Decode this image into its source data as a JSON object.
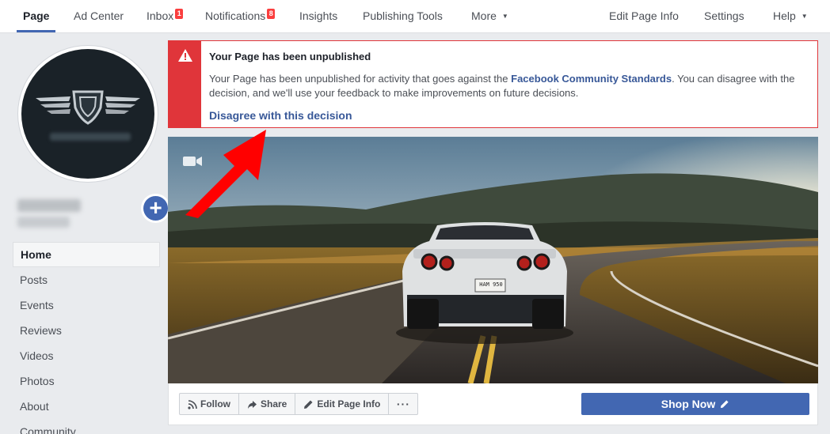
{
  "topnav": {
    "left": [
      {
        "label": "Page"
      },
      {
        "label": "Ad Center"
      },
      {
        "label": "Inbox",
        "badge": "1"
      },
      {
        "label": "Notifications",
        "badge": "8"
      },
      {
        "label": "Insights"
      },
      {
        "label": "Publishing Tools"
      },
      {
        "label": "More"
      }
    ],
    "right": [
      {
        "label": "Edit Page Info"
      },
      {
        "label": "Settings"
      },
      {
        "label": "Help"
      }
    ]
  },
  "sidebar": {
    "items": [
      {
        "label": "Home"
      },
      {
        "label": "Posts"
      },
      {
        "label": "Events"
      },
      {
        "label": "Reviews"
      },
      {
        "label": "Videos"
      },
      {
        "label": "Photos"
      },
      {
        "label": "About"
      },
      {
        "label": "Community"
      }
    ]
  },
  "alert": {
    "title": "Your Page has been unpublished",
    "body_before": "Your Page has been unpublished for activity that goes against the ",
    "body_link": "Facebook Community Standards",
    "body_after": ". You can disagree with the decision, and we'll use your feedback to make improvements on future decisions.",
    "action": "Disagree with this decision",
    "accent_color": "#e0353a"
  },
  "cover": {
    "plate": "HAM 950"
  },
  "actions": {
    "follow": "Follow",
    "share": "Share",
    "edit_page_info": "Edit Page Info",
    "more": "···",
    "shop_now": "Shop Now"
  },
  "colors": {
    "brand": "#4267b2",
    "link": "#385898",
    "alert_red": "#e0353a",
    "arrow_red": "#ff0000"
  }
}
